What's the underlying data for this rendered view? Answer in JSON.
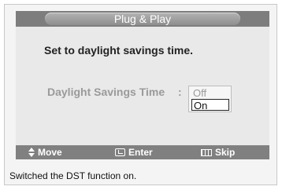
{
  "dialog": {
    "title": "Plug & Play",
    "heading": "Set to daylight  savings time.",
    "setting": {
      "label": "Daylight Savings Time",
      "separator": ":",
      "options": [
        "Off",
        "On"
      ],
      "selected": "On"
    }
  },
  "help_bar": {
    "move": {
      "label": "Move",
      "icon": "up-down-arrow-icon"
    },
    "enter": {
      "label": "Enter",
      "icon": "enter-icon"
    },
    "skip": {
      "label": "Skip",
      "icon": "skip-icon"
    }
  },
  "caption": "Switched the DST function on.",
  "colors": {
    "title_bar": "#7d7d7d",
    "screen_bg": "#e9e9e9",
    "help_bar": "#808080",
    "dim_text": "#9a9a9a"
  }
}
